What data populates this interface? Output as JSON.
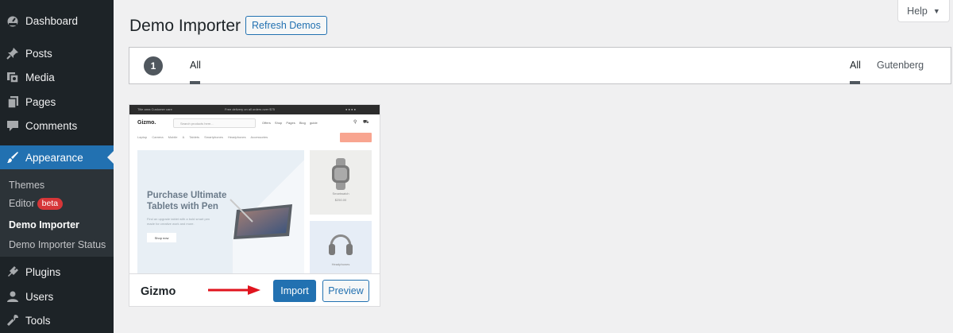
{
  "sidebar": {
    "items": [
      {
        "label": "Dashboard",
        "icon": "dashboard-icon"
      },
      {
        "label": "Posts",
        "icon": "pin-icon"
      },
      {
        "label": "Media",
        "icon": "media-icon"
      },
      {
        "label": "Pages",
        "icon": "pages-icon"
      },
      {
        "label": "Comments",
        "icon": "comment-icon"
      },
      {
        "label": "Appearance",
        "icon": "brush-icon",
        "active": true
      },
      {
        "label": "Plugins",
        "icon": "plug-icon"
      },
      {
        "label": "Users",
        "icon": "user-icon"
      },
      {
        "label": "Tools",
        "icon": "wrench-icon"
      }
    ],
    "submenu": {
      "themes": "Themes",
      "editor": "Editor",
      "editor_badge": "beta",
      "demo_importer": "Demo Importer",
      "demo_importer_status": "Demo Importer Status"
    }
  },
  "header": {
    "title": "Demo Importer",
    "refresh_label": "Refresh Demos",
    "help_label": "Help"
  },
  "filter_bar": {
    "count": "1",
    "left_tab": "All",
    "right_tabs": [
      "All",
      "Gutenberg"
    ]
  },
  "theme_card": {
    "name": "Gizmo",
    "import_label": "Import",
    "preview_label": "Preview",
    "screenshot": {
      "topbar_left": "Title area    Customer care",
      "topbar_center": "Free delivery on all orders over $75",
      "logo": "Gizmo.",
      "search_placeholder": "Search products here...",
      "nav_links": "Offers  Shop  Pages  Blog guide",
      "categories": "Laptop  Camera  Mobile & Tablets  Smartphones  Headphones  Accessories",
      "hero_title_1": "Purchase Ultimate",
      "hero_title_2": "Tablets with Pen",
      "hero_text": "Find an upgrade tablet with a bold smart pen made for creative work and more.",
      "shop_label": "Shop now",
      "side1_label": "Smartwatch",
      "side1_price": "$250.00",
      "side2_label": "Headphones"
    }
  },
  "colors": {
    "sidebar_bg": "#1d2327",
    "accent": "#2271b1",
    "badge_red": "#d63638",
    "arrow_red": "#e0141e"
  }
}
